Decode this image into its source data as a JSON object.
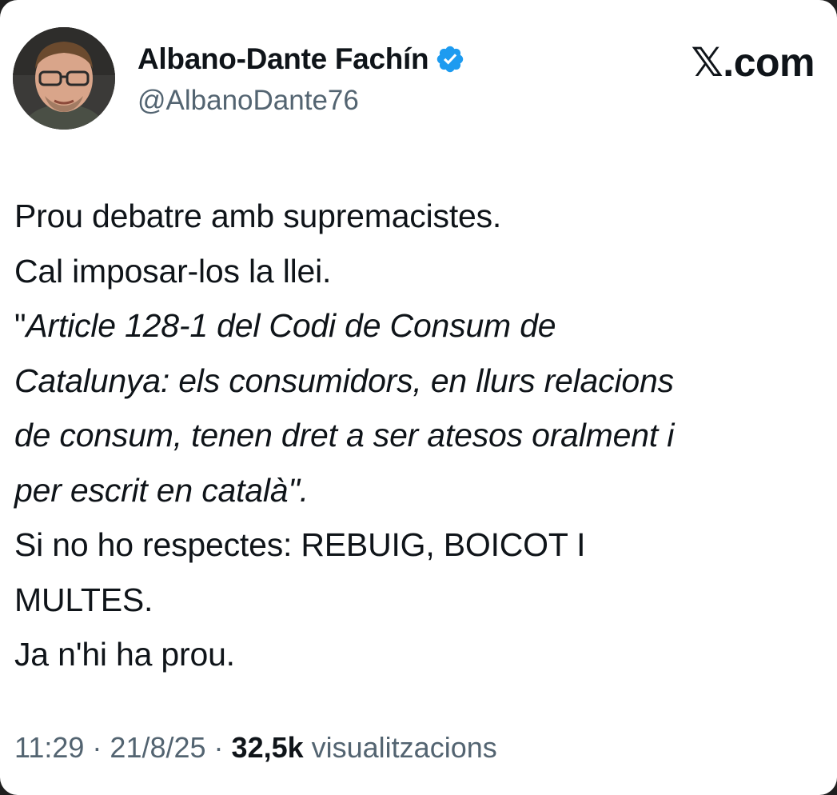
{
  "author": {
    "display_name": "Albano-Dante Fachín",
    "handle": "@AlbanoDante76",
    "verified": true
  },
  "brand": "𝕏.com",
  "tweet": {
    "lines": [
      "Prou debatre amb supremacistes.",
      "Cal imposar-los la llei.",
      "\"",
      "Article 128-1 del Codi de Consum de",
      "Catalunya: els consumidors, en llurs relacions",
      "de consum, tenen dret a ser atesos oralment i",
      "per escrit en català\".",
      "Si no ho respectes: REBUIG, BOICOT I",
      "MULTES.",
      "Ja n'hi ha prou."
    ]
  },
  "meta": {
    "time": "11:29",
    "sep1": " · ",
    "date": "21/8/25",
    "sep2": " · ",
    "views_count": "32,5k",
    "views_label": " visualitzacions"
  },
  "colors": {
    "verified_badge": "#1d9bf0",
    "secondary_text": "#536471",
    "primary_text": "#0f1419"
  },
  "icons": {
    "verified": "verified-badge-icon",
    "avatar": "profile-photo"
  }
}
